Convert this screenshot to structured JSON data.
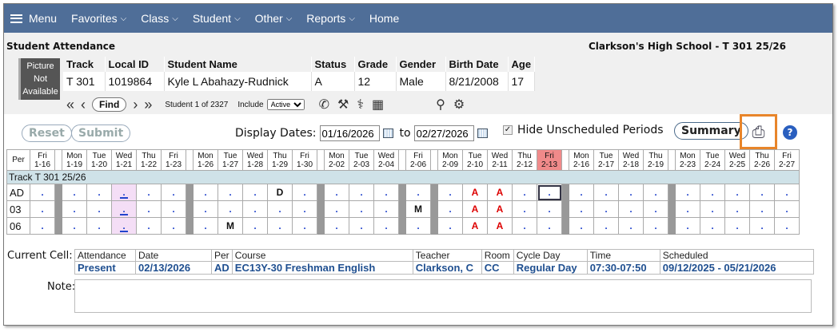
{
  "nav": {
    "menu": "Menu",
    "items": [
      "Favorites",
      "Class",
      "Student",
      "Other",
      "Reports"
    ],
    "home": "Home"
  },
  "header": {
    "title": "Student Attendance",
    "school": "Clarkson's High School - T 301 25/26"
  },
  "photo": [
    "Picture",
    "Not",
    "Available"
  ],
  "student": {
    "headers": [
      "Track",
      "Local ID",
      "Student Name",
      "Status",
      "Grade",
      "Gender",
      "Birth Date",
      "Age"
    ],
    "values": [
      "T 301",
      "1019864",
      "Kyle L Abahazy-Rudnick",
      "A",
      "12",
      "Male",
      "8/21/2008",
      "17"
    ]
  },
  "find_label": "Find",
  "counter": "Student 1 of 2327",
  "include_label": "Include",
  "include_value": "Active",
  "controls": {
    "reset": "Reset",
    "submit": "Submit",
    "display_dates": "Display Dates:",
    "from": "01/16/2026",
    "to_word": "to",
    "to": "02/27/2026",
    "hide_unscheduled": "Hide Unscheduled Periods",
    "summary": "Summary",
    "help": "?"
  },
  "grid": {
    "per_label": "Per",
    "track_band": "Track T 301 25/26",
    "columns": [
      "Fri|1-16",
      "G",
      "Mon|1-19",
      "Tue|1-20",
      "Wed|1-21",
      "Thu|1-22",
      "Fri|1-23",
      "G",
      "Mon|1-26",
      "Tue|1-27",
      "Wed|1-28",
      "Thu|1-29",
      "Fri|1-30",
      "G",
      "Mon|2-02",
      "Tue|2-03",
      "Wed|2-04",
      "G",
      "Fri|2-06",
      "G",
      "Mon|2-09",
      "Tue|2-10",
      "Wed|2-11",
      "Thu|2-12",
      "Fri|2-13",
      "G",
      "Mon|2-16",
      "Tue|2-17",
      "Wed|2-18",
      "Thu|2-19",
      "G",
      "Mon|2-23",
      "Tue|2-24",
      "Wed|2-25",
      "Thu|2-26",
      "Fri|2-27"
    ],
    "rows": [
      {
        "per": "AD",
        "marks": [
          ".",
          "G",
          ".",
          ".",
          "u",
          ".",
          ".",
          "G",
          ".",
          ".",
          ".",
          "D",
          ".",
          "G",
          ".",
          ".",
          ".",
          "G",
          ".",
          "G",
          ".",
          "A",
          "A",
          ".",
          "s",
          "G",
          ".",
          ".",
          ".",
          ".",
          "G",
          ".",
          ".",
          ".",
          ".",
          "."
        ]
      },
      {
        "per": "03",
        "marks": [
          ".",
          "G",
          ".",
          ".",
          "u",
          ".",
          ".",
          "G",
          ".",
          ".",
          ".",
          ".",
          ".",
          "G",
          ".",
          ".",
          ".",
          "G",
          "M",
          "G",
          ".",
          "A",
          "A",
          ".",
          ".",
          "G",
          ".",
          ".",
          ".",
          ".",
          "G",
          ".",
          ".",
          ".",
          ".",
          "."
        ]
      },
      {
        "per": "06",
        "marks": [
          ".",
          "G",
          ".",
          ".",
          "u",
          ".",
          ".",
          "G",
          ".",
          "M",
          ".",
          ".",
          ".",
          "G",
          ".",
          ".",
          ".",
          "G",
          ".",
          "G",
          ".",
          "A",
          "A",
          ".",
          ".",
          "G",
          ".",
          ".",
          ".",
          ".",
          "G",
          ".",
          ".",
          ".",
          ".",
          "."
        ]
      }
    ]
  },
  "current_cell": {
    "label": "Current Cell:",
    "labels": [
      "Attendance",
      "Date",
      "Per",
      "Course",
      "Teacher",
      "Room",
      "Cycle Day",
      "Time",
      "Scheduled"
    ],
    "values": [
      "Present",
      "02/13/2026",
      "AD",
      "EC13Y-30 Freshman English",
      "Clarkson, C",
      "CC",
      "Regular Day",
      "07:30-07:50",
      "09/12/2025 - 05/21/2026"
    ]
  },
  "note_label": "Note:"
}
